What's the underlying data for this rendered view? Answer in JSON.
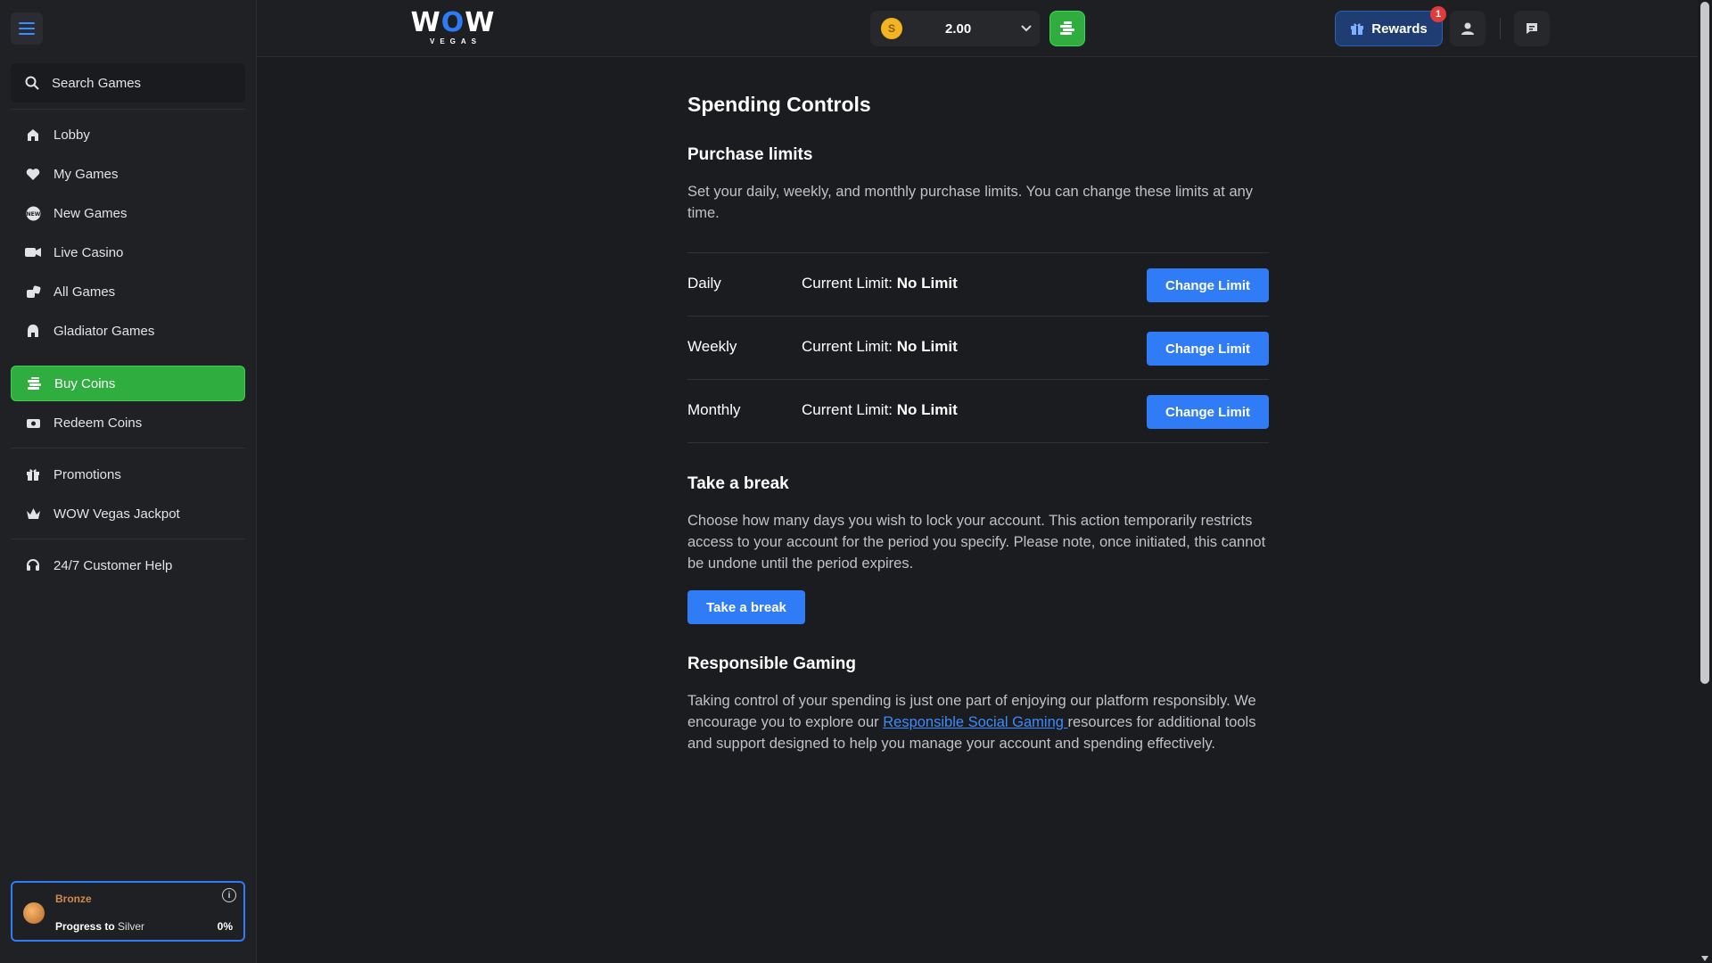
{
  "brand": {
    "logo_top": "WOW",
    "logo_sub": "VEGAS"
  },
  "search": {
    "label": "Search Games"
  },
  "sidebar": {
    "items": [
      {
        "label": "Lobby",
        "icon": "lobby-icon"
      },
      {
        "label": "My Games",
        "icon": "heart-icon"
      },
      {
        "label": "New Games",
        "icon": "new-badge-icon"
      },
      {
        "label": "Live Casino",
        "icon": "live-casino-icon"
      },
      {
        "label": "All Games",
        "icon": "dice-icon"
      },
      {
        "label": "Gladiator Games",
        "icon": "gladiator-helmet-icon"
      },
      {
        "label": "Buy Coins",
        "icon": "coins-stack-icon",
        "active": true
      },
      {
        "label": "Redeem Coins",
        "icon": "redeem-icon"
      },
      {
        "label": "Promotions",
        "icon": "gift-icon"
      },
      {
        "label": "WOW Vegas Jackpot",
        "icon": "crown-icon"
      },
      {
        "label": "24/7 Customer Help",
        "icon": "headset-icon"
      }
    ],
    "tier": {
      "name": "Bronze",
      "progress_prefix": "Progress to",
      "next_tier": "Silver",
      "percent": "0%"
    }
  },
  "header": {
    "coin_symbol": "S",
    "balance": "2.00",
    "rewards_label": "Rewards",
    "rewards_badge": "1"
  },
  "page": {
    "title": "Spending Controls",
    "purchase": {
      "heading": "Purchase limits",
      "description": "Set your daily, weekly, and monthly purchase limits. You can change these limits at any time.",
      "current_label": "Current Limit:",
      "button_label": "Change Limit",
      "rows": [
        {
          "period": "Daily",
          "value": "No Limit"
        },
        {
          "period": "Weekly",
          "value": "No Limit"
        },
        {
          "period": "Monthly",
          "value": "No Limit"
        }
      ]
    },
    "break": {
      "heading": "Take a break",
      "description": "Choose how many days you wish to lock your account. This action temporarily restricts access to your account for the period you specify. Please note, once initiated, this cannot be undone until the period expires.",
      "button_label": "Take a break"
    },
    "responsible": {
      "heading": "Responsible Gaming",
      "text_before": "Taking control of your spending is just one part of enjoying our platform responsibly. We encourage you to explore our ",
      "link_text": "Responsible Social Gaming ",
      "text_after": "resources for additional tools and support designed to help you manage your account and spending effectively."
    }
  },
  "colors": {
    "accent_blue": "#2f7cf6",
    "buy_green": "#2fae3f",
    "background": "#1b1c1f",
    "sidebar": "#202124"
  }
}
